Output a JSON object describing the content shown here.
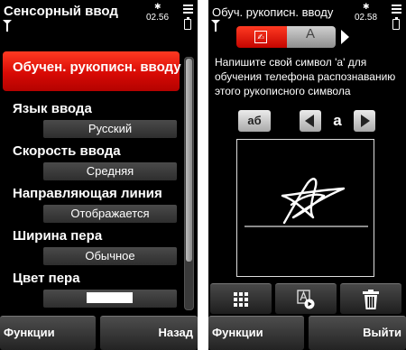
{
  "left": {
    "title": "Сенсорный ввод",
    "status": {
      "time": "02.56",
      "bluetooth": "✱"
    },
    "selected_item": "Обучен. рукописн. вводу",
    "settings": [
      {
        "label": "Язык ввода",
        "value": "Русский"
      },
      {
        "label": "Скорость ввода",
        "value": "Средняя"
      },
      {
        "label": "Направляющая линия",
        "value": "Отображается"
      },
      {
        "label": "Ширина пера",
        "value": "Обычное"
      },
      {
        "label": "Цвет пера",
        "swatch_color": "#ffffff"
      }
    ],
    "softkeys": {
      "left": "Функции",
      "right": "Назад"
    },
    "scrollbar": {
      "position": 0,
      "visible_fraction": 0.8
    }
  },
  "right": {
    "title": "Обуч. рукописн. вводу",
    "status": {
      "time": "02.58",
      "bluetooth": "✱"
    },
    "tabs": [
      {
        "icon": "handwriting-tab-icon",
        "glyph": "✍",
        "active": true
      },
      {
        "icon": "font-tab-icon",
        "glyph": "A",
        "active": false
      }
    ],
    "instruction": "Напишите свой символ 'a' для обучения телефона распознаванию этого рукописного символа",
    "keyboard_button": "аб",
    "current_symbol": "a",
    "toolbar": [
      {
        "name": "grid-icon"
      },
      {
        "name": "play-symbol-icon"
      },
      {
        "name": "trash-icon"
      }
    ],
    "softkeys": {
      "left": "Функции",
      "right": "Выйти"
    },
    "colors": {
      "accent": "#e0140b",
      "background": "#000000",
      "pad_border": "#dddddd"
    }
  }
}
